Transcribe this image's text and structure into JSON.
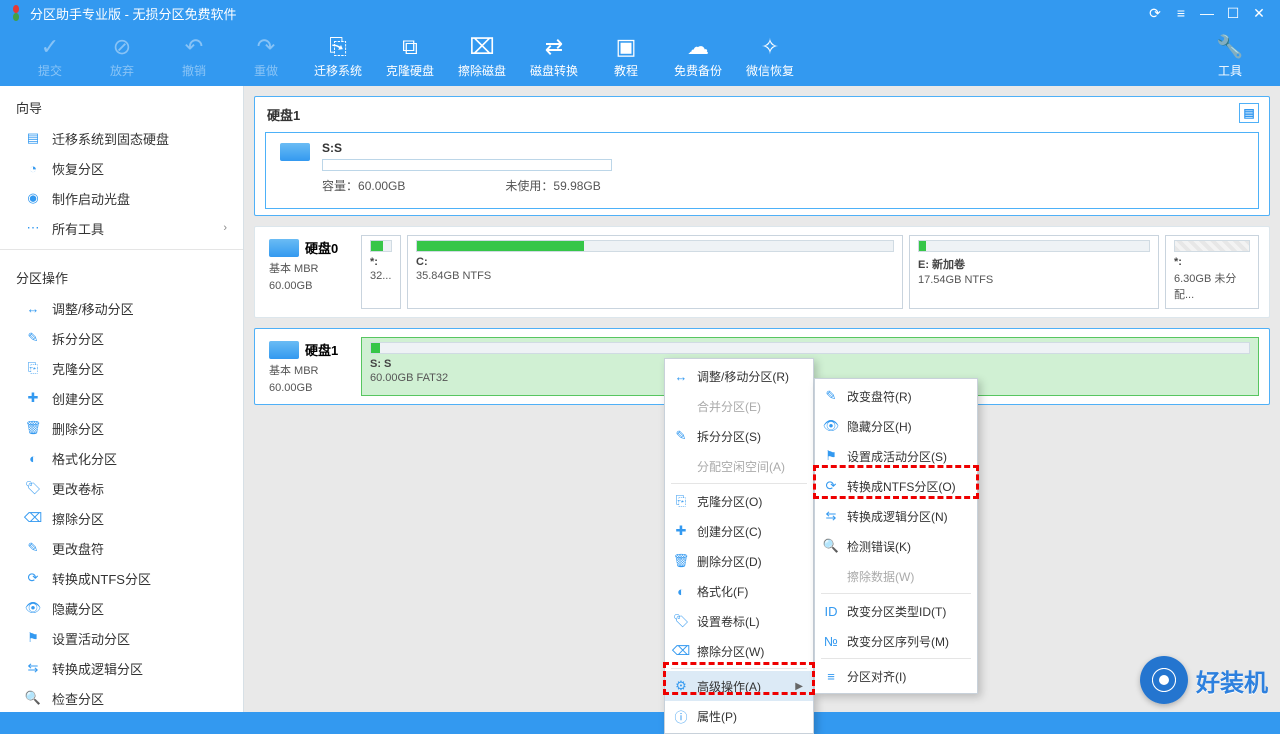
{
  "titlebar": {
    "text": "分区助手专业版 - 无损分区免费软件"
  },
  "toolbar": {
    "commit": "提交",
    "discard": "放弃",
    "undo": "撤销",
    "redo": "重做",
    "migrate": "迁移系统",
    "clone": "克隆硬盘",
    "wipe": "擦除磁盘",
    "convert": "磁盘转换",
    "tutorial": "教程",
    "backup": "免费备份",
    "wechat": "微信恢复",
    "tools": "工具"
  },
  "sidebar": {
    "wizard_title": "向导",
    "wizard": [
      {
        "label": "迁移系统到固态硬盘"
      },
      {
        "label": "恢复分区"
      },
      {
        "label": "制作启动光盘"
      },
      {
        "label": "所有工具"
      }
    ],
    "ops_title": "分区操作",
    "ops": [
      {
        "label": "调整/移动分区"
      },
      {
        "label": "拆分分区"
      },
      {
        "label": "克隆分区"
      },
      {
        "label": "创建分区"
      },
      {
        "label": "删除分区"
      },
      {
        "label": "格式化分区"
      },
      {
        "label": "更改卷标"
      },
      {
        "label": "擦除分区"
      },
      {
        "label": "更改盘符"
      },
      {
        "label": "转换成NTFS分区"
      },
      {
        "label": "隐藏分区"
      },
      {
        "label": "设置活动分区"
      },
      {
        "label": "转换成逻辑分区"
      },
      {
        "label": "检查分区"
      }
    ]
  },
  "panel1": {
    "title": "硬盘1",
    "drive": "S:S",
    "cap_label": "容量：",
    "cap": "60.00GB",
    "unused_label": "未使用：",
    "unused": "59.98GB"
  },
  "disk0": {
    "name": "硬盘0",
    "type": "基本 MBR",
    "size": "60.00GB",
    "p1_label": "*:",
    "p1_size": "32...",
    "p2_label": "C:",
    "p2_size": "35.84GB NTFS",
    "p3_label": "E: 新加卷",
    "p3_size": "17.54GB NTFS",
    "p4_label": "*:",
    "p4_size": "6.30GB 未分配..."
  },
  "disk1": {
    "name": "硬盘1",
    "type": "基本 MBR",
    "size": "60.00GB",
    "p1_label": "S: S",
    "p1_size": "60.00GB FAT32"
  },
  "ctx1": {
    "resize": "调整/移动分区(R)",
    "merge": "合并分区(E)",
    "split": "拆分分区(S)",
    "allocate": "分配空闲空间(A)",
    "clone": "克隆分区(O)",
    "create": "创建分区(C)",
    "delete": "删除分区(D)",
    "format": "格式化(F)",
    "label": "设置卷标(L)",
    "wipe": "擦除分区(W)",
    "advanced": "高级操作(A)",
    "props": "属性(P)"
  },
  "ctx2": {
    "letter": "改变盘符(R)",
    "hide": "隐藏分区(H)",
    "active": "设置成活动分区(S)",
    "ntfs": "转换成NTFS分区(O)",
    "logical": "转换成逻辑分区(N)",
    "check": "检测错误(K)",
    "wipe": "擦除数据(W)",
    "id": "改变分区类型ID(T)",
    "serial": "改变分区序列号(M)",
    "align": "分区对齐(I)"
  },
  "brand_text": "好装机"
}
